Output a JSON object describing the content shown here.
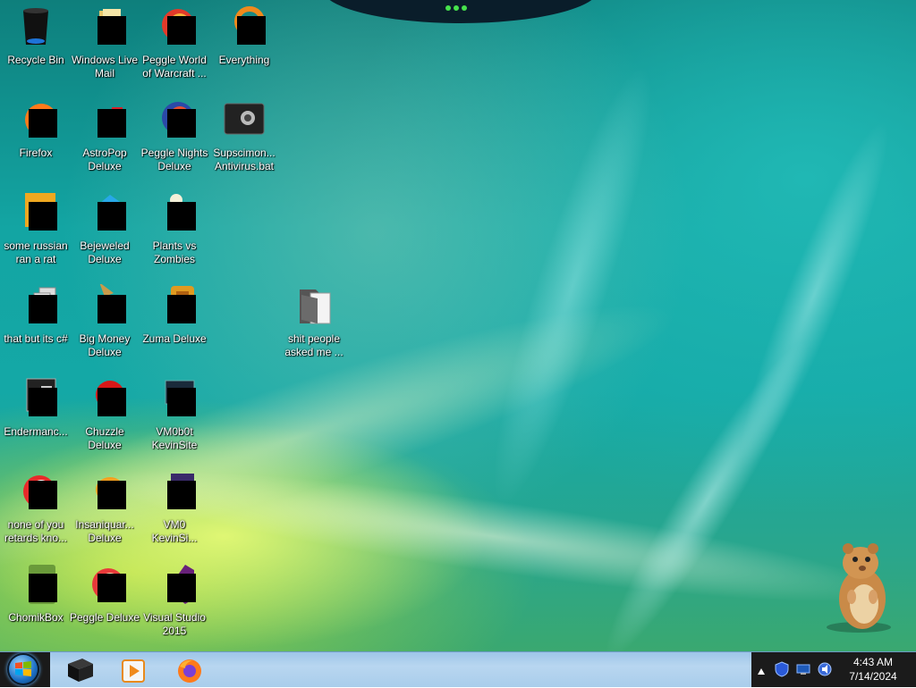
{
  "desktop": {
    "icons": [
      {
        "label": "Recycle Bin",
        "icon": "recycle-bin-icon"
      },
      {
        "label": "Windows Live\nMail",
        "icon": "mail-icon"
      },
      {
        "label": "Peggle World\nof Warcraft ...",
        "icon": "peggle-icon"
      },
      {
        "label": "Everything",
        "icon": "search-icon"
      },
      {
        "label": "Firefox",
        "icon": "firefox-icon"
      },
      {
        "label": "AstroPop\nDeluxe",
        "icon": "game-icon"
      },
      {
        "label": "Peggle Nights\nDeluxe",
        "icon": "peggle-icon"
      },
      {
        "label": "Supscimon...\nAntivirus.bat",
        "icon": "batch-file-icon"
      },
      {
        "label": "some russian\nran a rat",
        "icon": "document-icon"
      },
      {
        "label": "Bejeweled\nDeluxe",
        "icon": "gem-icon"
      },
      {
        "label": "Plants vs\nZombies",
        "icon": "plant-icon"
      },
      {
        "label": "that but its c#",
        "icon": "copy-icon"
      },
      {
        "label": "Big Money\nDeluxe",
        "icon": "game-icon"
      },
      {
        "label": "Zuma Deluxe",
        "icon": "game-icon"
      },
      {
        "label": "shit people\nasked me ...",
        "icon": "folder-icon"
      },
      {
        "label": "Endermanc...",
        "icon": "terminal-icon"
      },
      {
        "label": "Chuzzle\nDeluxe",
        "icon": "game-icon"
      },
      {
        "label": "VM0b0t\nKevinSite",
        "icon": "monitor-icon"
      },
      {
        "label": "none of you\nretards kno...",
        "icon": "peggle-icon"
      },
      {
        "label": "Insaniquar...\nDeluxe",
        "icon": "fish-icon"
      },
      {
        "label": "VM0\nKevinSi...",
        "icon": "monitor-icon"
      },
      {
        "label": "ChomikBox",
        "icon": "hamster-box-icon"
      },
      {
        "label": "Peggle Deluxe",
        "icon": "peggle-icon"
      },
      {
        "label": "Visual Studio\n2015",
        "icon": "visual-studio-icon"
      }
    ]
  },
  "taskbar": {
    "pinned": [
      {
        "icon": "recycle-bin-icon"
      },
      {
        "icon": "media-player-icon"
      },
      {
        "icon": "firefox-icon"
      }
    ],
    "tray": {
      "icons": [
        "show-hidden-icons-icon",
        "shield-icon",
        "network-icon",
        "volume-icon"
      ],
      "time": "4:43 AM",
      "date": "7/14/2024"
    }
  },
  "colors": {
    "taskbar": "#b8d6f0",
    "wallpaper_teal": "#14a8a6",
    "wallpaper_yellow": "#e4f060"
  }
}
